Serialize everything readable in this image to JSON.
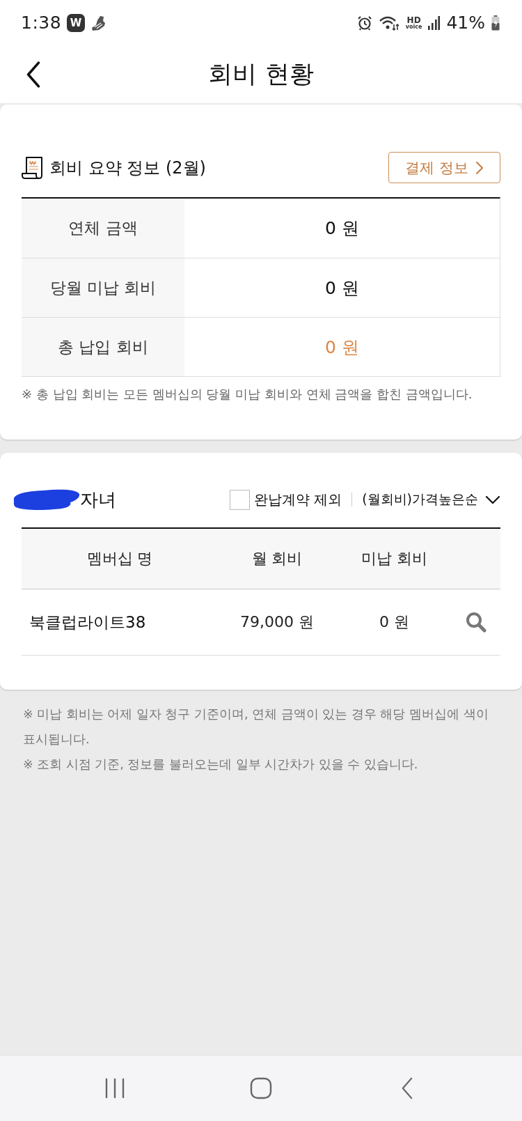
{
  "status_bar": {
    "time": "1:38",
    "app_badge": "W",
    "hd_label": "HD",
    "voice_label": "voice",
    "battery": "41%"
  },
  "header": {
    "title": "회비 현황"
  },
  "summary": {
    "title": "회비 요약 정보 (2월)",
    "payment_button": "결제 정보",
    "rows": [
      {
        "label": "연체 금액",
        "value": "0 원",
        "highlight": false
      },
      {
        "label": "당월 미납 회비",
        "value": "0 원",
        "highlight": false
      },
      {
        "label": "총 납입 회비",
        "value": "0 원",
        "highlight": true
      }
    ],
    "note": "※ 총 납입 회비는 모든 멤버십의 당월 미납 회비와 연체 금액을 합친 금액입니다."
  },
  "members": {
    "redacted": true,
    "group_label": "자녀",
    "exclude_paid": {
      "label": "완납계약 제외",
      "checked": false
    },
    "sort": {
      "label": "(월회비)가격높은순"
    },
    "columns": [
      "멤버십 명",
      "월 회비",
      "미납 회비"
    ],
    "rows": [
      {
        "name": "북클럽라이트38",
        "monthly_fee": "79,000 원",
        "unpaid_fee": "0 원"
      }
    ]
  },
  "notes": [
    "※ 미납 회비는 어제 일자 청구 기준이며, 연체 금액이 있는 경우 해당 멤버십에 색이 표시됩니다.",
    "※ 조회 시점 기준, 정보를 불러오는데 일부 시간차가 있을 수 있습니다."
  ]
}
